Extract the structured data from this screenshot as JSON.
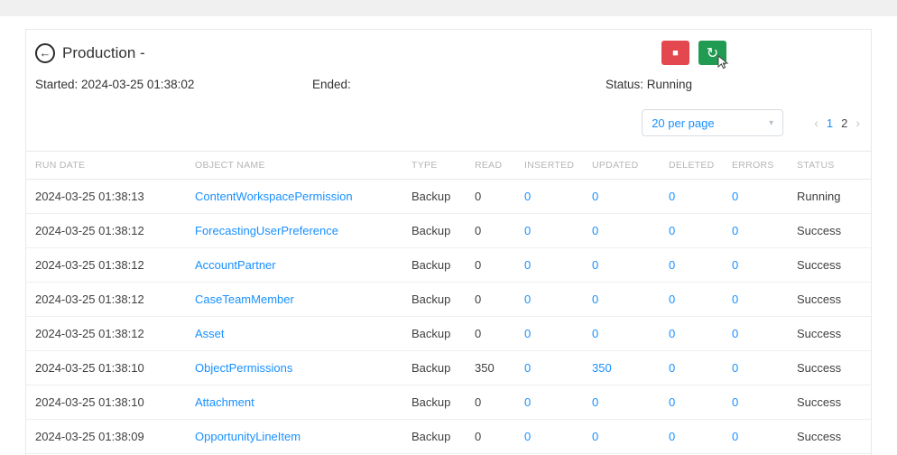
{
  "icons": {
    "back": "←",
    "stop": "■",
    "refresh": "↻",
    "caret": "▾"
  },
  "header": {
    "title": "Production -"
  },
  "info": {
    "started": "Started: 2024-03-25 01:38:02",
    "ended": "Ended:",
    "status": "Status: Running"
  },
  "controls": {
    "page_size": "20 per page",
    "pagination": {
      "prev": "‹",
      "pages": [
        "1",
        "2"
      ],
      "current": "1",
      "next": "›"
    }
  },
  "table": {
    "columns": [
      "RUN DATE",
      "OBJECT NAME",
      "TYPE",
      "READ",
      "INSERTED",
      "UPDATED",
      "DELETED",
      "ERRORS",
      "STATUS"
    ],
    "rows": [
      {
        "run_date": "2024-03-25 01:38:13",
        "object_name": "ContentWorkspacePermission",
        "type": "Backup",
        "read": "0",
        "inserted": "0",
        "updated": "0",
        "deleted": "0",
        "errors": "0",
        "status": "Running"
      },
      {
        "run_date": "2024-03-25 01:38:12",
        "object_name": "ForecastingUserPreference",
        "type": "Backup",
        "read": "0",
        "inserted": "0",
        "updated": "0",
        "deleted": "0",
        "errors": "0",
        "status": "Success"
      },
      {
        "run_date": "2024-03-25 01:38:12",
        "object_name": "AccountPartner",
        "type": "Backup",
        "read": "0",
        "inserted": "0",
        "updated": "0",
        "deleted": "0",
        "errors": "0",
        "status": "Success"
      },
      {
        "run_date": "2024-03-25 01:38:12",
        "object_name": "CaseTeamMember",
        "type": "Backup",
        "read": "0",
        "inserted": "0",
        "updated": "0",
        "deleted": "0",
        "errors": "0",
        "status": "Success"
      },
      {
        "run_date": "2024-03-25 01:38:12",
        "object_name": "Asset",
        "type": "Backup",
        "read": "0",
        "inserted": "0",
        "updated": "0",
        "deleted": "0",
        "errors": "0",
        "status": "Success"
      },
      {
        "run_date": "2024-03-25 01:38:10",
        "object_name": "ObjectPermissions",
        "type": "Backup",
        "read": "350",
        "inserted": "0",
        "updated": "350",
        "deleted": "0",
        "errors": "0",
        "status": "Success"
      },
      {
        "run_date": "2024-03-25 01:38:10",
        "object_name": "Attachment",
        "type": "Backup",
        "read": "0",
        "inserted": "0",
        "updated": "0",
        "deleted": "0",
        "errors": "0",
        "status": "Success"
      },
      {
        "run_date": "2024-03-25 01:38:09",
        "object_name": "OpportunityLineItem",
        "type": "Backup",
        "read": "0",
        "inserted": "0",
        "updated": "0",
        "deleted": "0",
        "errors": "0",
        "status": "Success"
      }
    ]
  },
  "colors": {
    "link": "#1890ff",
    "stop_button": "#e2484d",
    "refresh_button": "#219a52"
  }
}
